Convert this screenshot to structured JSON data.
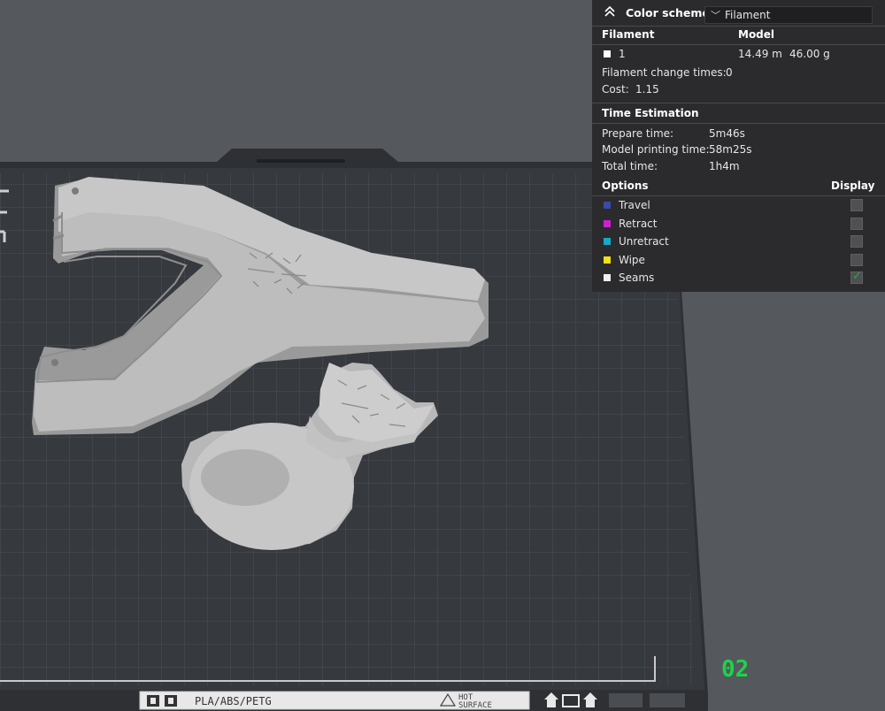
{
  "legend": {
    "color_scheme_label": "Color scheme",
    "color_scheme_value": "Filament",
    "table_header": {
      "filament": "Filament",
      "model": "Model"
    },
    "filament_row": {
      "index": "1",
      "length": "14.49 m",
      "weight": "46.00 g",
      "swatch_color": "#ffffff"
    },
    "filament_change": {
      "label": "Filament change times:",
      "value": "0"
    },
    "cost": {
      "label": "Cost:",
      "value": "1.15"
    },
    "time_estimation_title": "Time Estimation",
    "times": [
      {
        "label": "Prepare time:",
        "value": "5m46s"
      },
      {
        "label": "Model printing time:",
        "value": "58m25s"
      },
      {
        "label": "Total time:",
        "value": "1h4m"
      }
    ],
    "options_header": {
      "options": "Options",
      "display": "Display"
    },
    "options": [
      {
        "label": "Travel",
        "color": "#3b4aa6",
        "checked": false
      },
      {
        "label": "Retract",
        "color": "#d21ed2",
        "checked": false
      },
      {
        "label": "Unretract",
        "color": "#18a8c8",
        "checked": false
      },
      {
        "label": "Wipe",
        "color": "#f0e214",
        "checked": false
      },
      {
        "label": "Seams",
        "color": "#f0f0f0",
        "checked": true
      }
    ]
  },
  "plate": {
    "plate_number": "02",
    "plate_label_material": "PLA/ABS/PETG",
    "plate_label_hot": "HOT",
    "plate_label_surface": "SURFACE"
  }
}
